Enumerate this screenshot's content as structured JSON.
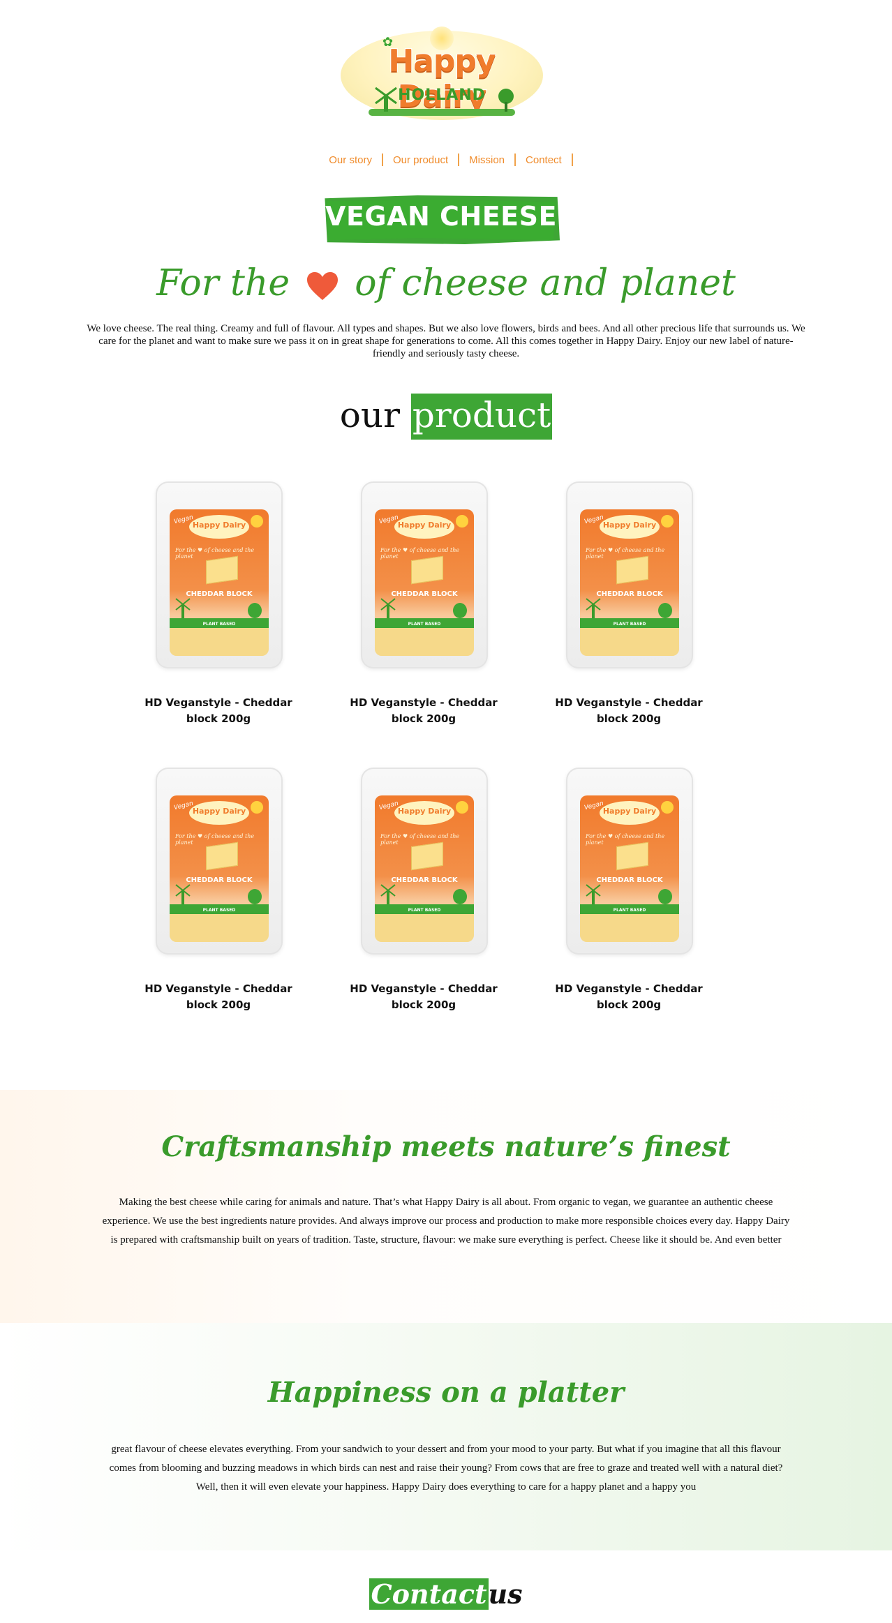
{
  "brand": {
    "logo_title": "Happy Dairy",
    "logo_subtitle": "HOLLAND",
    "accent_orange": "#f08c2c",
    "accent_green": "#3ea635"
  },
  "nav": {
    "items": [
      {
        "label": "Our story"
      },
      {
        "label": "Our product"
      },
      {
        "label": "Mission"
      },
      {
        "label": "Contect"
      }
    ]
  },
  "banner": {
    "label": "VEGAN CHEESE"
  },
  "tagline": {
    "before": "For the",
    "icon": "heart-icon",
    "after": "of cheese and planet"
  },
  "intro": {
    "text": "We love cheese. The real thing. Creamy and full of flavour. All types and shapes. But we also love flowers, birds and bees. And all other precious life that surrounds us. We care for the planet and want to make sure we pass it on in great shape for generations to come. All this comes together in Happy Dairy. Enjoy our new label of nature-friendly and seriously tasty cheese."
  },
  "products_heading": {
    "word1": "our",
    "word2": "product"
  },
  "products": [
    {
      "name": "HD Veganstyle - Cheddar block 200g"
    },
    {
      "name": "HD Veganstyle - Cheddar block 200g"
    },
    {
      "name": "HD Veganstyle - Cheddar block 200g"
    },
    {
      "name": "HD Veganstyle - Cheddar block 200g"
    },
    {
      "name": "HD Veganstyle - Cheddar block 200g"
    },
    {
      "name": "HD Veganstyle - Cheddar block 200g"
    }
  ],
  "package_label": {
    "brand": "Happy Dairy",
    "badge": "Vegan",
    "tagline": "For the ♥ of cheese and the planet",
    "product": "CHEDDAR BLOCK",
    "footer": "PLANT BASED"
  },
  "craft": {
    "title": "Craftsmanship meets nature’s finest",
    "text": "Making the best cheese while caring for animals and nature. That’s what Happy Dairy is all about. From organic to vegan, we guarantee an authentic cheese experience. We use the best ingredients nature provides. And always improve our process and production to make more responsible choices every day. Happy Dairy is prepared with craftsmanship built on years of tradition. Taste, structure, flavour: we make sure everything is perfect. Cheese like it should be. And even better"
  },
  "happy": {
    "title": "Happiness on a platter",
    "text": "great flavour of cheese elevates everything. From your sandwich to your dessert and from your mood to your party. But what if you imagine that all this flavour comes from blooming and buzzing meadows in which birds can nest and raise their young? From cows that are free to graze and treated well with a natural diet? Well, then it will even elevate your happiness. Happy Dairy does everything to care for a happy planet and a happy you"
  },
  "contact": {
    "word1": "Contact",
    "word2": "us"
  }
}
